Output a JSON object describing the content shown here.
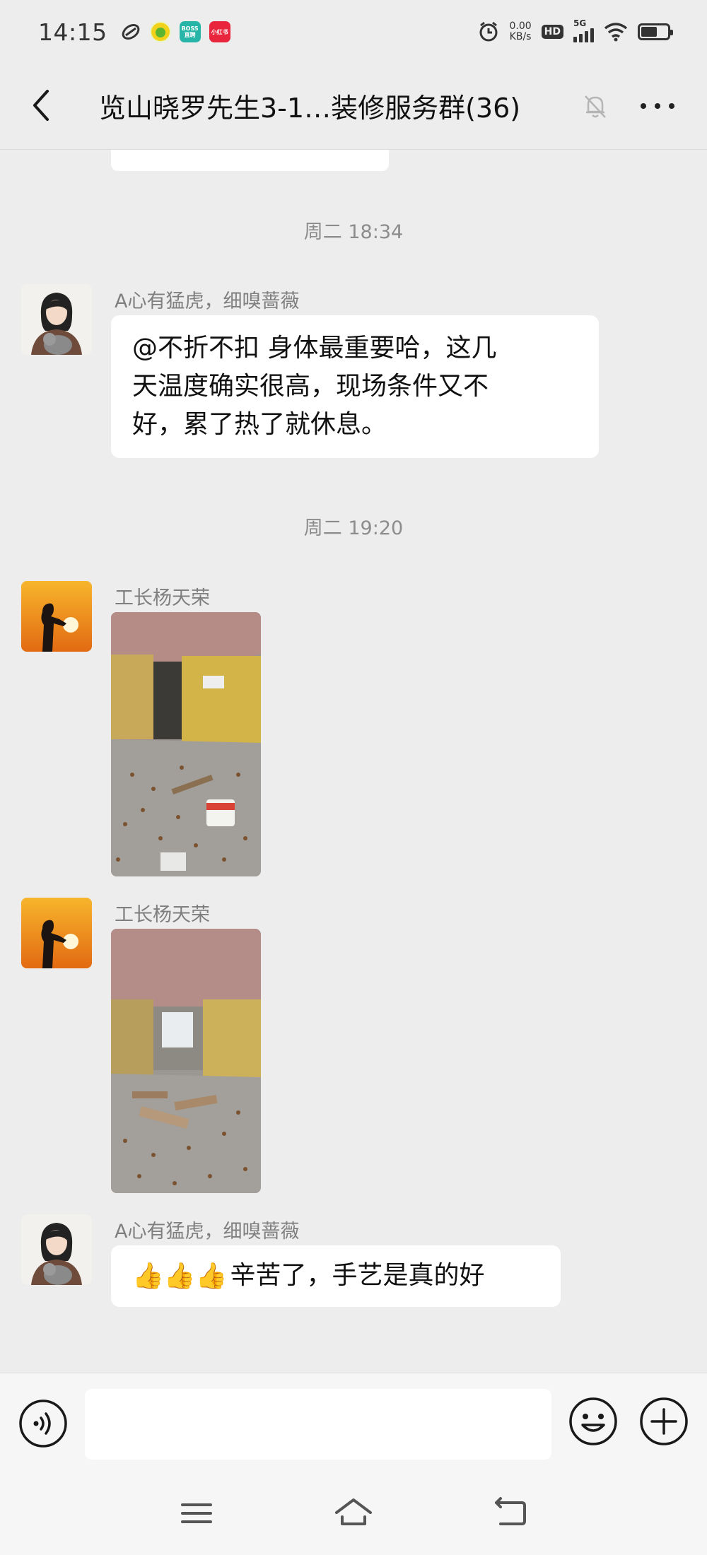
{
  "status_bar": {
    "time": "14:15",
    "apps": [
      {
        "name": "swirl-app-icon",
        "label": "",
        "color": "#333333"
      },
      {
        "name": "green-app-icon",
        "label": "",
        "color": "#f5c518"
      },
      {
        "name": "boss-app-icon",
        "label": "BOSS\n直聘",
        "color": "#27b5a8"
      },
      {
        "name": "xiaohongshu-app-icon",
        "label": "小红书",
        "color": "#e8253c"
      }
    ],
    "net_speed_value": "0.00",
    "net_speed_unit": "KB/s",
    "hd_label": "HD",
    "network_label": "5G",
    "battery_level": 0.6
  },
  "header": {
    "title": "览山晓罗先生3-1…装修服务群(36)"
  },
  "chat": {
    "timestamps": [
      "周二 18:34",
      "周二 19:20"
    ],
    "messages": [
      {
        "sender": "A心有猛虎，细嗅蔷薇",
        "lines": [
          "@不折不扣  身体最重要哈，这几",
          "天温度确实很高，现场条件又不",
          "好，累了热了就休息。"
        ]
      },
      {
        "sender": "工长杨天荣",
        "type": "image"
      },
      {
        "sender": "工长杨天荣",
        "type": "image"
      },
      {
        "sender": "A心有猛虎，细嗅蔷薇",
        "emoji": "👍👍👍",
        "text": "辛苦了，手艺是真的好"
      }
    ]
  },
  "colors": {
    "background": "#ededed",
    "bubble": "#ffffff",
    "timestamp": "#8c8c8c",
    "sender_name": "#7f7f7f"
  }
}
